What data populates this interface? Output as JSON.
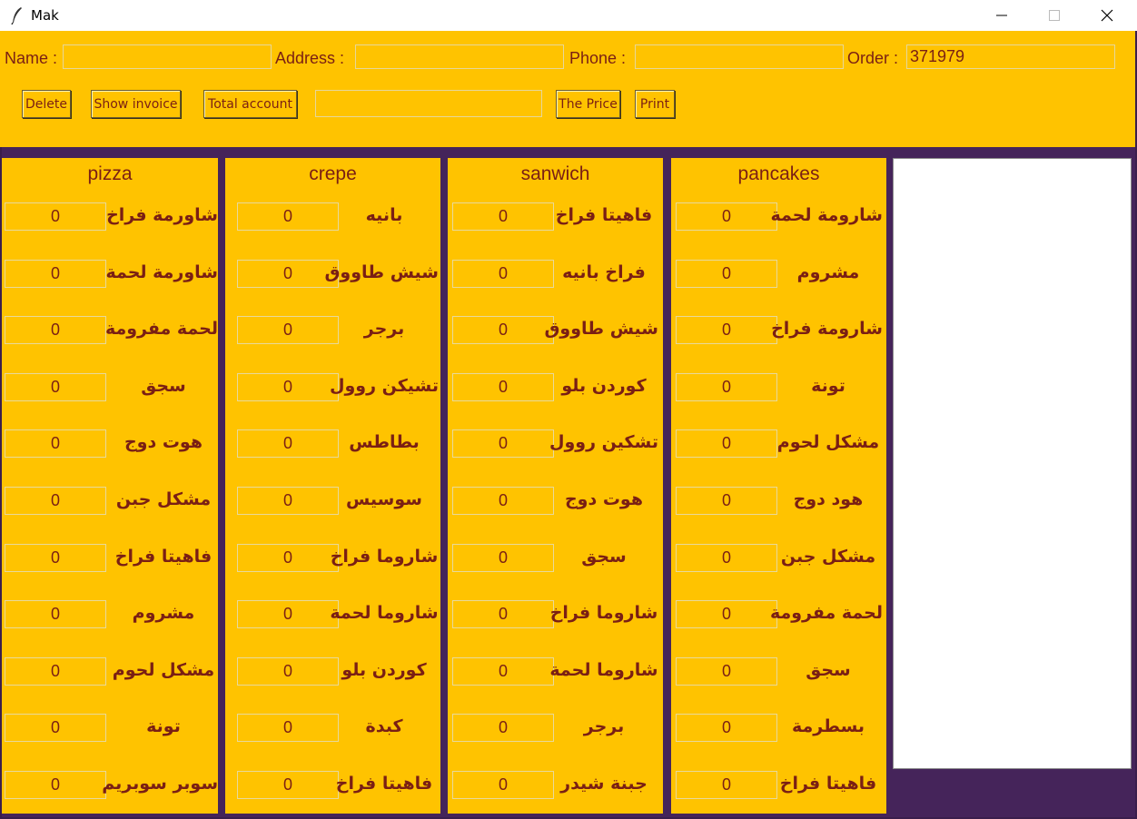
{
  "window": {
    "title": "Mak"
  },
  "form": {
    "name_label": "Name :",
    "name_value": "",
    "address_label": "Address :",
    "address_value": "",
    "phone_label": "Phone :",
    "phone_value": "",
    "order_label": "Order :",
    "order_value": "371979"
  },
  "toolbar": {
    "delete": "Delete",
    "show_invoice": "Show invoice",
    "total_account": "Total account",
    "total_value": "",
    "the_price": "The Price",
    "print": "Print"
  },
  "columns": [
    {
      "title": "pizza",
      "items": [
        {
          "name": "شاورمة فراخ",
          "qty": "0"
        },
        {
          "name": "شاورمة لحمة",
          "qty": "0"
        },
        {
          "name": "لحمة مفرومة",
          "qty": "0"
        },
        {
          "name": "سجق",
          "qty": "0"
        },
        {
          "name": "هوت دوج",
          "qty": "0"
        },
        {
          "name": "مشكل جبن",
          "qty": "0"
        },
        {
          "name": "فاهيتا فراخ",
          "qty": "0"
        },
        {
          "name": "مشروم",
          "qty": "0"
        },
        {
          "name": "مشكل لحوم",
          "qty": "0"
        },
        {
          "name": "تونة",
          "qty": "0"
        },
        {
          "name": "سوبر سوبريم",
          "qty": "0"
        }
      ]
    },
    {
      "title": "crepe",
      "items": [
        {
          "name": "بانيه",
          "qty": "0"
        },
        {
          "name": "شيش طاووق",
          "qty": "0"
        },
        {
          "name": "برجر",
          "qty": "0"
        },
        {
          "name": "تشيكن روول",
          "qty": "0"
        },
        {
          "name": "بطاطس",
          "qty": "0"
        },
        {
          "name": "سوسيس",
          "qty": "0"
        },
        {
          "name": "شاروما فراخ",
          "qty": "0"
        },
        {
          "name": "شاروما لحمة",
          "qty": "0"
        },
        {
          "name": "كوردن بلو",
          "qty": "0"
        },
        {
          "name": "كبدة",
          "qty": "0"
        },
        {
          "name": "فاهيتا فراخ",
          "qty": "0"
        }
      ]
    },
    {
      "title": "sanwich",
      "items": [
        {
          "name": "فاهيتا فراخ",
          "qty": "0"
        },
        {
          "name": "فراخ بانيه",
          "qty": "0"
        },
        {
          "name": "شيش طاووق",
          "qty": "0"
        },
        {
          "name": "كوردن بلو",
          "qty": "0"
        },
        {
          "name": "تشكين روول",
          "qty": "0"
        },
        {
          "name": "هوت دوج",
          "qty": "0"
        },
        {
          "name": "سجق",
          "qty": "0"
        },
        {
          "name": "شاروما فراخ",
          "qty": "0"
        },
        {
          "name": "شاروما لحمة",
          "qty": "0"
        },
        {
          "name": "برجر",
          "qty": "0"
        },
        {
          "name": "جبنة شيدر",
          "qty": "0"
        }
      ]
    },
    {
      "title": "pancakes",
      "items": [
        {
          "name": "شارومة لحمة",
          "qty": "0"
        },
        {
          "name": "مشروم",
          "qty": "0"
        },
        {
          "name": "شارومة فراخ",
          "qty": "0"
        },
        {
          "name": "تونة",
          "qty": "0"
        },
        {
          "name": "مشكل لحوم",
          "qty": "0"
        },
        {
          "name": "هود دوج",
          "qty": "0"
        },
        {
          "name": "مشكل جبن",
          "qty": "0"
        },
        {
          "name": "لحمة مفرومة",
          "qty": "0"
        },
        {
          "name": "سجق",
          "qty": "0"
        },
        {
          "name": "بسطرمة",
          "qty": "0"
        },
        {
          "name": "فاهيتا فراخ",
          "qty": "0"
        }
      ]
    }
  ],
  "receipt": {
    "text": ""
  },
  "colors": {
    "panel": "#ffc300",
    "background": "#45245a",
    "text": "#7a1f14"
  },
  "icons": {
    "app": "feather-icon",
    "minimize": "minimize-icon",
    "maximize": "maximize-icon",
    "close": "close-icon"
  }
}
